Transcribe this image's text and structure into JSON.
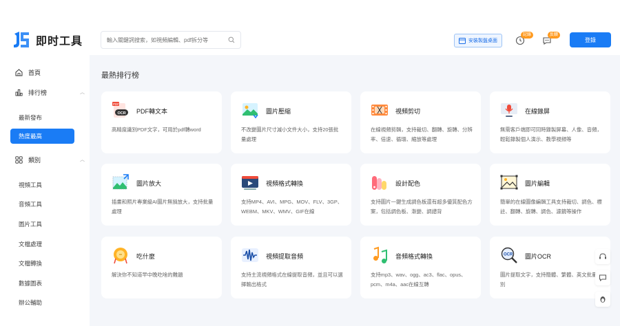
{
  "app": {
    "name": "即时工具"
  },
  "search": {
    "placeholder": "輸入關鍵詞搜索，如視頻編輯、pdf拆分等"
  },
  "header": {
    "install_label": "安裝製盤桌面",
    "history_badge": "記錄",
    "message_badge": "反饋",
    "login_label": "登錄"
  },
  "sidebar": {
    "home": "首頁",
    "ranking": "排行榜",
    "ranking_items": [
      "最新發布",
      "熱度最高"
    ],
    "categories": "類別",
    "category_items": [
      "視頻工具",
      "音頻工具",
      "圖片工具",
      "文檔處理",
      "文檔轉換",
      "數據圖表",
      "辦公輔助"
    ]
  },
  "main": {
    "section_title": "最熱排行榜",
    "cards": [
      {
        "title": "PDF轉文本",
        "desc": "高精度識別PDF文字，可用於pdf轉word",
        "icon": "pdf-ocr-icon"
      },
      {
        "title": "圖片壓縮",
        "desc": "不改變圖片尺寸減小文件大小，支持20張批量處理",
        "icon": "image-compress-icon"
      },
      {
        "title": "視頻剪切",
        "desc": "在線視頻剪輯，支持裁切、翻轉、旋轉、分辨率、倍速、循環、縮放等處理",
        "icon": "video-cut-icon"
      },
      {
        "title": "在線錄屏",
        "desc": "無需客戶端即可同時錄製屏幕、人像、音頻，輕鬆錄製個人演示、教學視頻等",
        "icon": "screen-record-icon"
      },
      {
        "title": "圖片放大",
        "desc": "插畫和照片專業級AI圖片無損放大，支持批量處理",
        "icon": "image-enlarge-icon"
      },
      {
        "title": "視頻格式轉換",
        "desc": "支持MP4、AVI、MPG、MOV、FLV、3GP、WEBM、MKV、WMV、GIF在線",
        "icon": "video-convert-icon"
      },
      {
        "title": "設計配色",
        "desc": "支持圖片一鍵生成調色板還有超多優質配色方案，包括調色板、漸變、調譜背",
        "icon": "color-palette-icon"
      },
      {
        "title": "圖片編輯",
        "desc": "簡單的在線圖像編輯工具支持裁切、調色、標註、翻轉、旋轉、調色、濾鏡等操作",
        "icon": "image-edit-icon"
      },
      {
        "title": "吃什麼",
        "desc": "解決你不知道早中晚吃啥的難題",
        "icon": "eat-what-icon"
      },
      {
        "title": "視頻提取音頻",
        "desc": "支持主流視頻格式在線提取音頻，並且可以選擇輸出格式",
        "icon": "audio-extract-icon"
      },
      {
        "title": "音頻格式轉換",
        "desc": "支持mp3、wav、ogg、ac3、flac、opus、pcm、m4a、aac在線互轉",
        "icon": "audio-convert-icon"
      },
      {
        "title": "圖片OCR",
        "desc": "圖片提取文字，支持簡體、繁體、英文批量識別",
        "icon": "image-ocr-icon"
      }
    ]
  },
  "colors": {
    "primary": "#1a7cf5",
    "badge": "#ff9a1f",
    "background": "#f4f6fa"
  }
}
